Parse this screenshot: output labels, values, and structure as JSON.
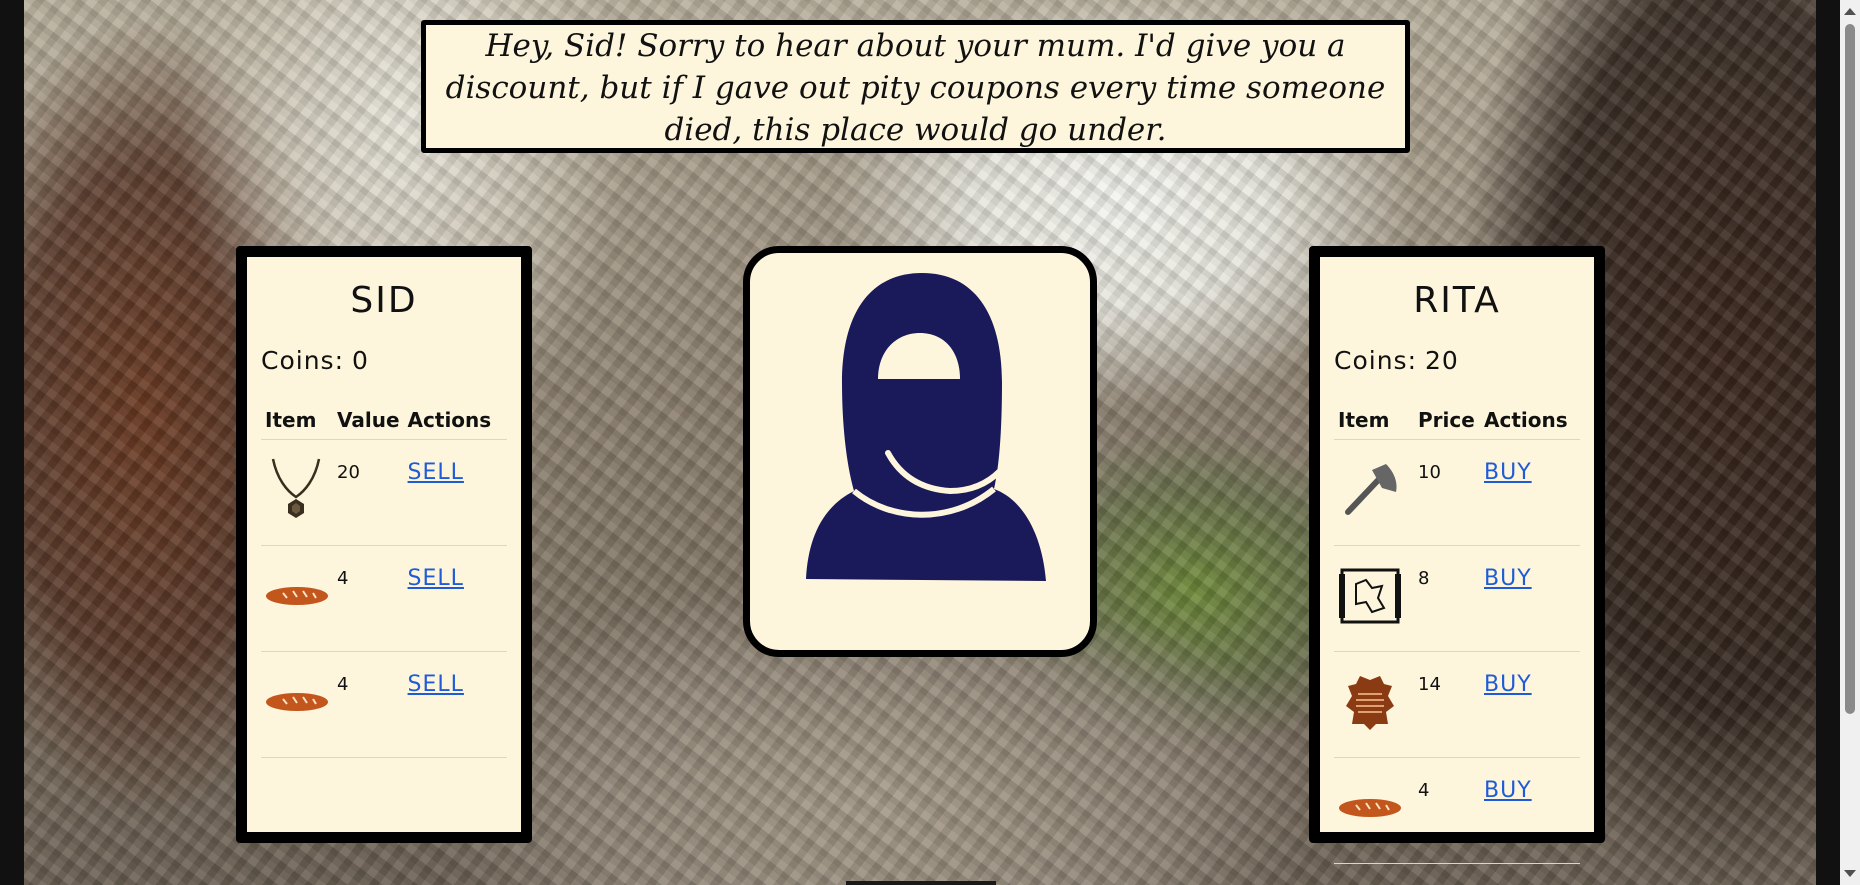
{
  "dialogue": {
    "line1": "Hey, Sid! Sorry to hear about your mum. I'd give you a",
    "line2": "discount, but if I gave out pity coupons every time someone",
    "line3": "died, this place would go under."
  },
  "player": {
    "name": "SID",
    "coins_label": "Coins:",
    "coins": "0",
    "columns": [
      "Item",
      "Value",
      "Actions"
    ],
    "items": [
      {
        "icon": "amulet-icon",
        "value": "20",
        "action": "SELL"
      },
      {
        "icon": "bread-icon",
        "value": "4",
        "action": "SELL"
      },
      {
        "icon": "bread-icon",
        "value": "4",
        "action": "SELL"
      }
    ]
  },
  "merchant": {
    "name": "RITA",
    "coins_label": "Coins:",
    "coins": "20",
    "columns": [
      "Item",
      "Price",
      "Actions"
    ],
    "items": [
      {
        "icon": "axe-icon",
        "value": "10",
        "action": "BUY"
      },
      {
        "icon": "map-icon",
        "value": "8",
        "action": "BUY"
      },
      {
        "icon": "leather-hide-icon",
        "value": "14",
        "action": "BUY"
      },
      {
        "icon": "bread-icon",
        "value": "4",
        "action": "BUY"
      }
    ]
  },
  "portrait": {
    "icon": "hooded-figure-icon",
    "color": "#1a1a5a"
  },
  "colors": {
    "panel_bg": "#fdf6dc",
    "link": "#1f5bd8",
    "bread": "#c2561c"
  }
}
